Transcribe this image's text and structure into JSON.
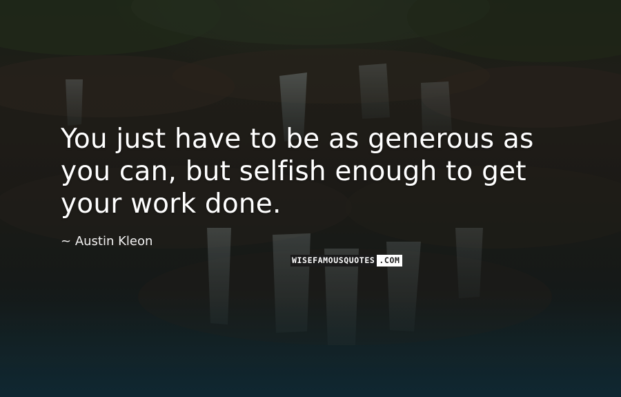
{
  "quote": {
    "text": "You just have to be as generous as you can, but selfish enough to get your work done.",
    "author_prefix": "~",
    "author": "Austin Kleon"
  },
  "watermark": {
    "dark_text": "WISEFAMOUSQUOTES",
    "light_text": ".COM"
  },
  "background": {
    "description_icon": "waterfall-photo",
    "tint": "#1c2a2c"
  }
}
